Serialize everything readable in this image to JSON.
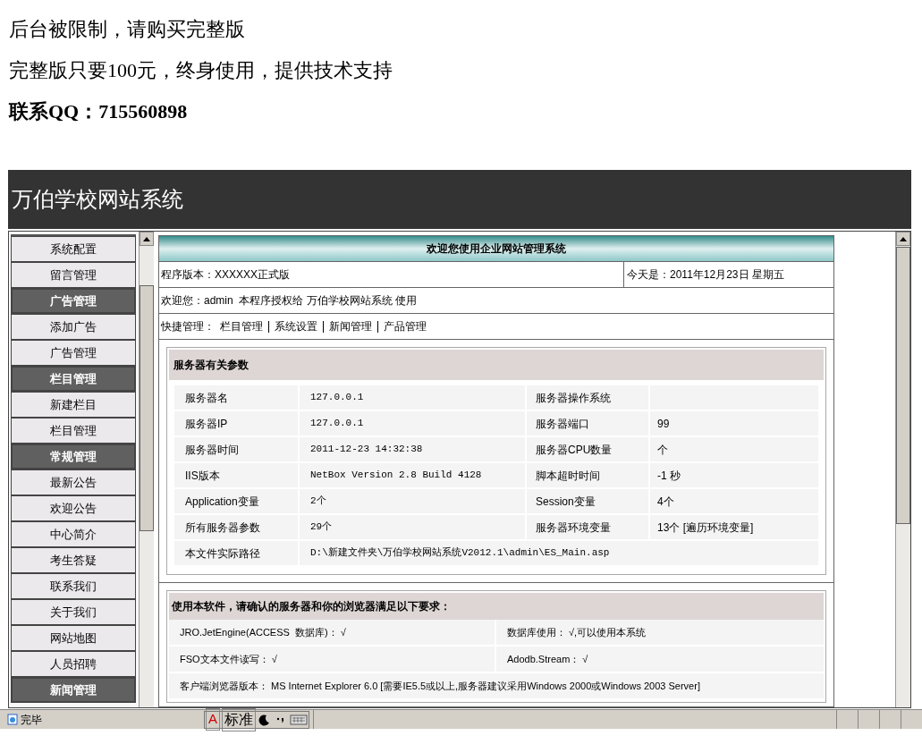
{
  "notice": [
    "后台被限制，请购买完整版",
    "完整版只要100元，终身使用，提供技术支持",
    "联系QQ：715560898"
  ],
  "header": {
    "title": "万伯学校网站系统"
  },
  "sidebar": {
    "items": [
      {
        "kind": "link",
        "label": "系统配置"
      },
      {
        "kind": "link",
        "label": "留言管理"
      },
      {
        "kind": "header",
        "label": "广告管理"
      },
      {
        "kind": "link",
        "label": "添加广告"
      },
      {
        "kind": "link",
        "label": "广告管理"
      },
      {
        "kind": "header",
        "label": "栏目管理"
      },
      {
        "kind": "link",
        "label": "新建栏目"
      },
      {
        "kind": "link",
        "label": "栏目管理"
      },
      {
        "kind": "header",
        "label": "常规管理"
      },
      {
        "kind": "link",
        "label": "最新公告"
      },
      {
        "kind": "link",
        "label": "欢迎公告"
      },
      {
        "kind": "link",
        "label": "中心简介"
      },
      {
        "kind": "link",
        "label": "考生答疑"
      },
      {
        "kind": "link",
        "label": "联系我们"
      },
      {
        "kind": "link",
        "label": "关于我们"
      },
      {
        "kind": "link",
        "label": "网站地图"
      },
      {
        "kind": "link",
        "label": "人员招聘"
      },
      {
        "kind": "header",
        "label": "新闻管理"
      }
    ]
  },
  "main": {
    "title": "欢迎您使用企业网站管理系统",
    "version": "程序版本：XXXXXX正式版",
    "today": "今天是：2011年12月23日 星期五",
    "welcome": "欢迎您：admin  本程序授权给 万伯学校网站系统 使用",
    "quick_label": "快捷管理：",
    "quick_links": [
      "栏目管理",
      "系统设置",
      "新闻管理",
      "产品管理"
    ],
    "server": {
      "title": "服务器有关参数",
      "rows": [
        [
          "服务器名",
          "127.0.0.1",
          "服务器操作系统"
        ],
        [
          "服务器IP",
          "127.0.0.1",
          "服务器端口",
          "99"
        ],
        [
          "服务器时间",
          "2011-12-23 14:32:38",
          "服务器CPU数量",
          "个"
        ],
        [
          "IIS版本",
          "NetBox Version 2.8 Build 4128",
          "脚本超时时间",
          "-1 秒"
        ],
        [
          "Application变量",
          "2个",
          "Session变量",
          "4个"
        ],
        [
          "所有服务器参数",
          "29个",
          "服务器环境变量",
          "13个 [遍历环境变量]"
        ],
        [
          "本文件实际路径",
          "D:\\新建文件夹\\万伯学校网站系统V2012.1\\admin\\ES_Main.asp"
        ]
      ]
    },
    "requirements": {
      "title": "使用本软件，请确认的服务器和你的浏览器满足以下要求：",
      "rows": [
        [
          "JRO.JetEngine(ACCESS  数据库)： √",
          "数据库使用： √,可以使用本系统"
        ],
        [
          "FSO文本文件读写： √",
          "Adodb.Stream： √"
        ],
        [
          "客户端浏览器版本： MS Internet Explorer 6.0 [需要IE5.5或以上,服务器建议采用Windows 2000或Windows 2003 Server]"
        ]
      ]
    }
  },
  "status_bar": {
    "text": "完毕",
    "ime": [
      "A",
      "标准"
    ]
  }
}
